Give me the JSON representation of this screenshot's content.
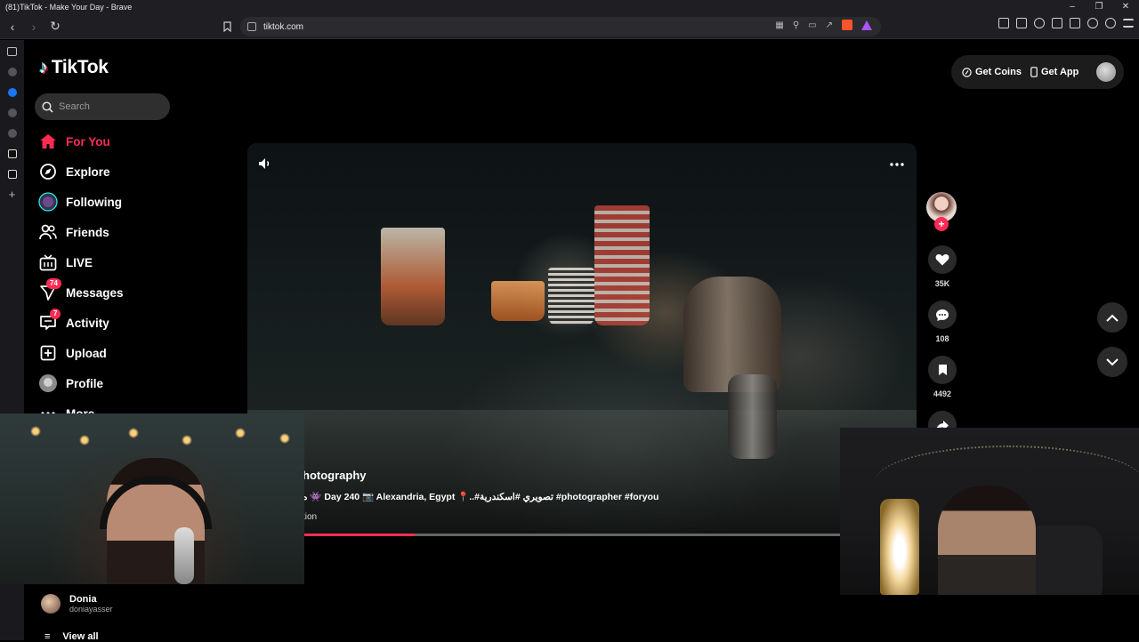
{
  "browser": {
    "window_title": "(81)TikTok - Make Your Day - Brave",
    "url": "tiktok.com"
  },
  "logo_text": "TikTok",
  "search": {
    "placeholder": "Search"
  },
  "nav": [
    {
      "label": "For You",
      "icon": "home-icon",
      "active": true
    },
    {
      "label": "Explore",
      "icon": "compass-icon"
    },
    {
      "label": "Following",
      "icon": "following-avatar-icon"
    },
    {
      "label": "Friends",
      "icon": "friends-icon"
    },
    {
      "label": "LIVE",
      "icon": "live-tv-icon"
    },
    {
      "label": "Messages",
      "icon": "send-icon",
      "badge": "74"
    },
    {
      "label": "Activity",
      "icon": "inbox-icon",
      "badge": "7"
    },
    {
      "label": "Upload",
      "icon": "plus-square-icon"
    },
    {
      "label": "Profile",
      "icon": "profile-avatar-icon"
    },
    {
      "label": "More",
      "icon": "more-icon"
    }
  ],
  "following_accounts": [
    {
      "name": "Donia",
      "handle": "doniayasser"
    }
  ],
  "view_all_label": "View all",
  "top_right": {
    "coins_label": "Get Coins",
    "app_label": "Get App"
  },
  "video": {
    "title": "hotography",
    "description": "ه 👾 Day 240 📷 Alexandria, Egypt 📍..#تصويري #اسكندرية #photographer #foryou",
    "sound": "tion",
    "progress": 0.25
  },
  "actions": {
    "likes": "35K",
    "comments": "108",
    "saves": "4492"
  },
  "colors": {
    "accent": "#fe2c55",
    "background": "#000000",
    "chrome": "#1f1f23"
  }
}
